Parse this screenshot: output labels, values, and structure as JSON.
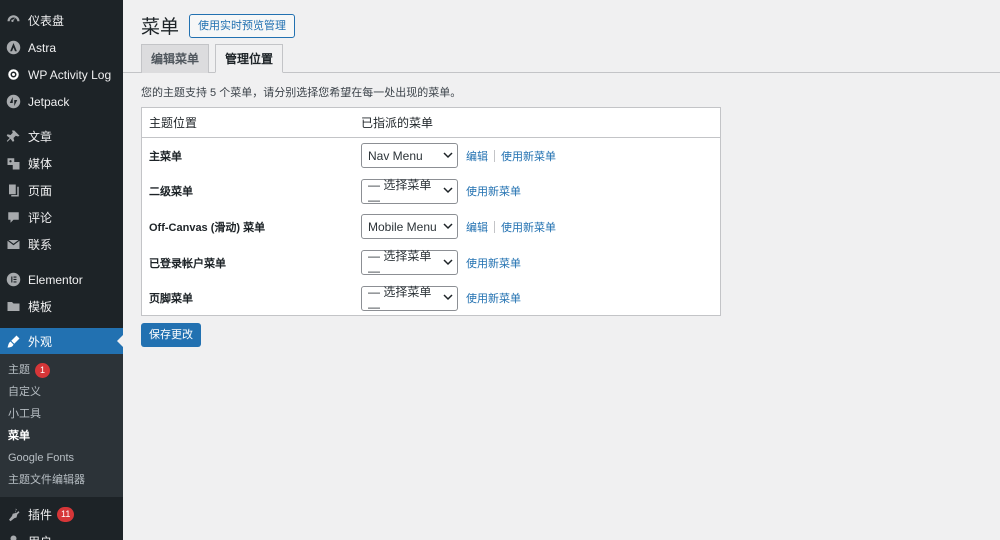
{
  "sidebar": {
    "top_items": [
      {
        "label": "仪表盘",
        "icon": "dashboard-icon"
      },
      {
        "label": "Astra",
        "icon": "astra-icon"
      },
      {
        "label": "WP Activity Log",
        "icon": "eye-icon"
      },
      {
        "label": "Jetpack",
        "icon": "jetpack-icon"
      }
    ],
    "content_items": [
      {
        "label": "文章",
        "icon": "pin-icon"
      },
      {
        "label": "媒体",
        "icon": "media-icon"
      },
      {
        "label": "页面",
        "icon": "page-icon"
      },
      {
        "label": "评论",
        "icon": "comment-icon"
      },
      {
        "label": "联系",
        "icon": "mail-icon"
      }
    ],
    "extra_items": [
      {
        "label": "Elementor",
        "icon": "elementor-icon"
      },
      {
        "label": "模板",
        "icon": "folder-icon"
      }
    ],
    "current": {
      "label": "外观",
      "icon": "brush-icon"
    },
    "submenu": [
      {
        "label": "主题",
        "badge": "1"
      },
      {
        "label": "自定义"
      },
      {
        "label": "小工具"
      },
      {
        "label": "菜单"
      },
      {
        "label": "Google Fonts"
      },
      {
        "label": "主题文件编辑器"
      }
    ],
    "after_items": [
      {
        "label": "插件",
        "icon": "plugin-icon",
        "badge": "11"
      },
      {
        "label": "用户",
        "icon": "user-icon"
      }
    ]
  },
  "header": {
    "title": "菜单",
    "action_label": "使用实时预览管理"
  },
  "tabs": [
    {
      "label": "编辑菜单",
      "active": false
    },
    {
      "label": "管理位置",
      "active": true
    }
  ],
  "intro": "您的主题支持 5 个菜单，请分别选择您希望在每一处出现的菜单。",
  "table": {
    "col_location": "主题位置",
    "col_menu": "已指派的菜单",
    "rows": [
      {
        "location": "主菜单",
        "selected": "Nav Menu",
        "edit": "编辑",
        "new": "使用新菜单"
      },
      {
        "location": "二级菜单",
        "selected": "— 选择菜单 —",
        "edit": "",
        "new": "使用新菜单"
      },
      {
        "location": "Off-Canvas (滑动) 菜单",
        "selected": "Mobile Menu",
        "edit": "编辑",
        "new": "使用新菜单"
      },
      {
        "location": "已登录帐户菜单",
        "selected": "— 选择菜单 —",
        "edit": "",
        "new": "使用新菜单"
      },
      {
        "location": "页脚菜单",
        "selected": "— 选择菜单 —",
        "edit": "",
        "new": "使用新菜单"
      }
    ]
  },
  "save_label": "保存更改",
  "colors": {
    "sidebar_bg": "#1d2327",
    "accent": "#2271b1",
    "badge": "#d63638"
  }
}
